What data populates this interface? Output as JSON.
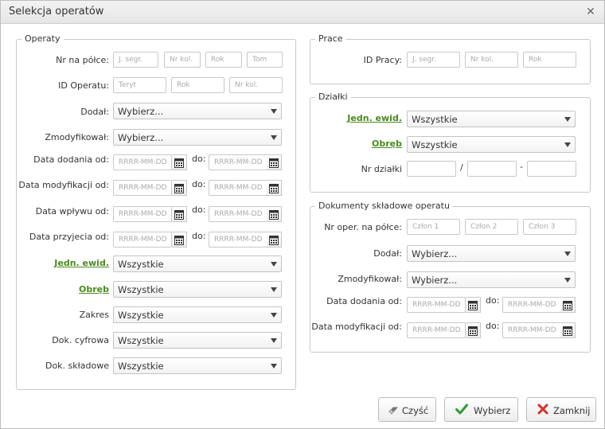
{
  "window": {
    "title": "Selekcja operatów"
  },
  "operaty": {
    "legend": "Operaty",
    "nr_na_polce": {
      "label": "Nr na półce:",
      "placeholders": [
        "J. segr.",
        "Nr kol.",
        "Rok",
        "Tom"
      ]
    },
    "id_operatu": {
      "label": "ID Operatu:",
      "placeholders": [
        "Teryt",
        "Rok",
        "Nr kol."
      ]
    },
    "dodal": {
      "label": "Dodał:",
      "value": "Wybierz..."
    },
    "zmodyfikowal": {
      "label": "Zmodyfikował:",
      "value": "Wybierz..."
    },
    "date_rows": [
      {
        "label": "Data dodania od:",
        "from": "RRRR-MM-DD",
        "to_label": "do:",
        "to": "RRRR-MM-DD"
      },
      {
        "label": "Data modyfikacji od:",
        "from": "RRRR-MM-DD",
        "to_label": "do:",
        "to": "RRRR-MM-DD"
      },
      {
        "label": "Data wpływu od:",
        "from": "RRRR-MM-DD",
        "to_label": "do:",
        "to": "RRRR-MM-DD"
      },
      {
        "label": "Data przyjecia od:",
        "from": "RRRR-MM-DD",
        "to_label": "do:",
        "to": "RRRR-MM-DD"
      }
    ],
    "jedn_ewid": {
      "label": "Jedn. ewid.",
      "value": "Wszystkie"
    },
    "obreb": {
      "label": "Obręb",
      "value": "Wszystkie"
    },
    "zakres": {
      "label": "Zakres",
      "value": "Wszystkie"
    },
    "dok_cyfrowa": {
      "label": "Dok. cyfrowa",
      "value": "Wszystkie"
    },
    "dok_skladowe": {
      "label": "Dok. składowe",
      "value": "Wszystkie"
    }
  },
  "prace": {
    "legend": "Prace",
    "id_pracy": {
      "label": "ID Pracy:",
      "placeholders": [
        "J. segr.",
        "Nr kol.",
        "Rok"
      ]
    }
  },
  "dzialki": {
    "legend": "Działki",
    "jedn_ewid": {
      "label": "Jedn. ewid.",
      "value": "Wszystkie"
    },
    "obreb": {
      "label": "Obręb",
      "value": "Wszystkie"
    },
    "nr_dzialki": {
      "label": "Nr działki",
      "sep1": "/",
      "sep2": "-"
    }
  },
  "dokumenty": {
    "legend": "Dokumenty składowe operatu",
    "nr_oper": {
      "label": "Nr oper. na półce:",
      "placeholders": [
        "Człon 1",
        "Człon 2",
        "Człon 3"
      ]
    },
    "dodal": {
      "label": "Dodał:",
      "value": "Wybierz..."
    },
    "zmodyfikowal": {
      "label": "Zmodyfikował:",
      "value": "Wybierz..."
    },
    "date_rows": [
      {
        "label": "Data dodania od:",
        "from": "RRRR-MM-DD",
        "to_label": "do:",
        "to": "RRRR-MM-DD"
      },
      {
        "label": "Data modyfikacji od:",
        "from": "RRRR-MM-DD",
        "to_label": "do:",
        "to": "RRRR-MM-DD"
      }
    ]
  },
  "buttons": {
    "clear": "Czyść",
    "select": "Wybierz",
    "close": "Zamknij"
  },
  "colors": {
    "link_green": "#4a8a1e",
    "check_green": "#2e9b2e",
    "close_red": "#d9302b"
  }
}
